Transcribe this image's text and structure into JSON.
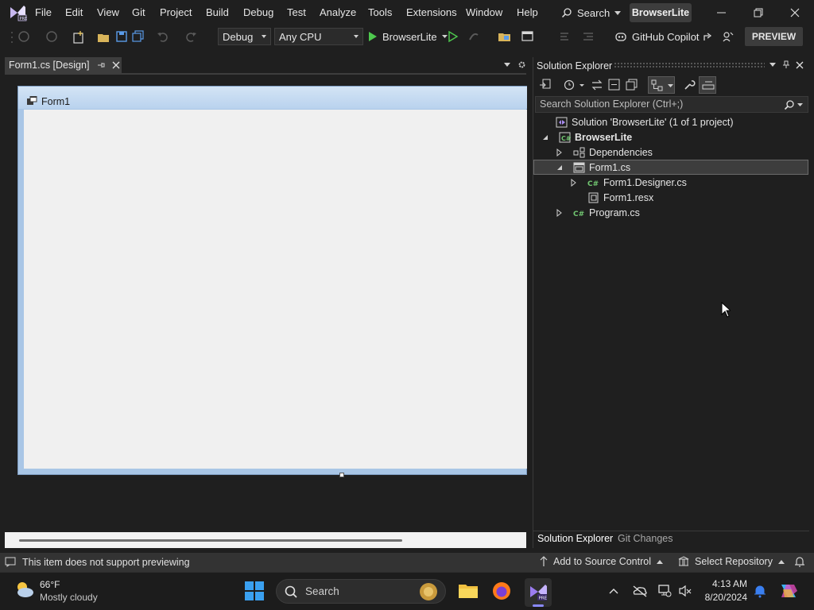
{
  "menu": {
    "items": [
      "File",
      "Edit",
      "View",
      "Git",
      "Project",
      "Build",
      "Debug",
      "Test",
      "Analyze",
      "Tools",
      "Extensions",
      "Window",
      "Help"
    ],
    "search_label": "Search",
    "solution_name": "BrowserLite"
  },
  "toolbar": {
    "config": "Debug",
    "platform": "Any CPU",
    "start_target": "BrowserLite",
    "copilot_label": "GitHub Copilot",
    "preview_label": "PREVIEW"
  },
  "document": {
    "tab_label": "Form1.cs [Design]",
    "form_title": "Form1"
  },
  "solution_explorer": {
    "title": "Solution Explorer",
    "search_placeholder": "Search Solution Explorer (Ctrl+;)",
    "tree": [
      {
        "label": "Solution 'BrowserLite' (1 of 1 project)",
        "icon": "solution-icon"
      },
      {
        "label": "BrowserLite",
        "icon": "csharp-project-icon"
      },
      {
        "label": "Dependencies",
        "icon": "dependencies-icon"
      },
      {
        "label": "Form1.cs",
        "icon": "form-icon"
      },
      {
        "label": "Form1.Designer.cs",
        "icon": "csharp-file-icon"
      },
      {
        "label": "Form1.resx",
        "icon": "resx-icon"
      },
      {
        "label": "Program.cs",
        "icon": "csharp-file-icon"
      }
    ],
    "bottom_tabs": [
      "Solution Explorer",
      "Git Changes"
    ]
  },
  "status": {
    "message": "This item does not support previewing",
    "source_control": "Add to Source Control",
    "repository": "Select Repository"
  },
  "taskbar": {
    "weather_temp": "66°F",
    "weather_desc": "Mostly cloudy",
    "search_label": "Search",
    "time": "4:13 AM",
    "date": "8/20/2024"
  },
  "colors": {
    "accent_purple": "#8a5cf6",
    "play_green": "#4ec94e",
    "csharp_green": "#71c671",
    "form_blue": "#b9d2ee"
  }
}
